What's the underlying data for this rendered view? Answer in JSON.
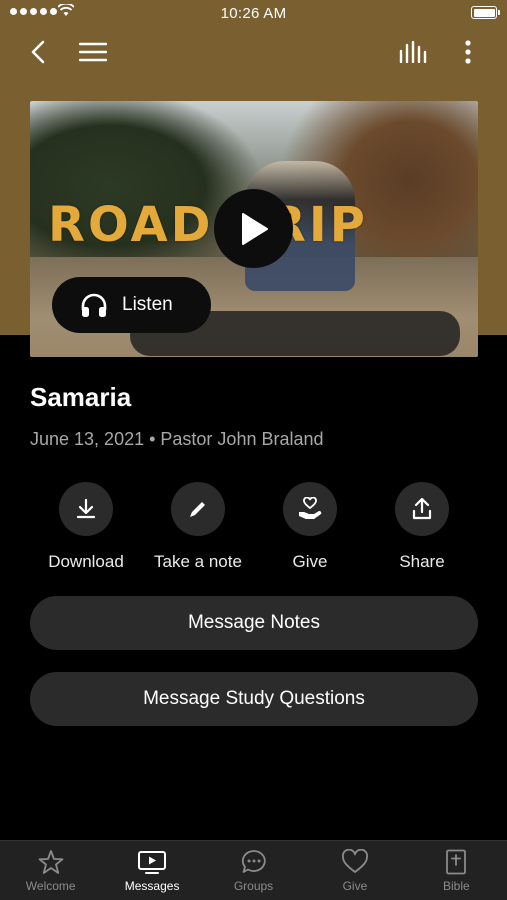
{
  "status_bar": {
    "time": "10:26 AM"
  },
  "header": {
    "back_icon": "chevron-left-icon",
    "menu_icon": "hamburger-icon",
    "audio_icon": "equalizer-icon",
    "more_icon": "more-vertical-icon"
  },
  "hero": {
    "title_art": "ROAD TRIP",
    "play_icon": "play-icon",
    "listen_label": "Listen"
  },
  "sermon": {
    "title": "Samaria",
    "meta": "June 13, 2021 • Pastor John Braland"
  },
  "actions": [
    {
      "label": "Download",
      "icon": "download-icon"
    },
    {
      "label": "Take a note",
      "icon": "pencil-icon"
    },
    {
      "label": "Give",
      "icon": "hand-heart-icon"
    },
    {
      "label": "Share",
      "icon": "share-icon"
    }
  ],
  "buttons": {
    "message_notes": "Message Notes",
    "study_questions": "Message Study Questions"
  },
  "tabs": [
    {
      "label": "Welcome",
      "icon": "star-icon",
      "active": false
    },
    {
      "label": "Messages",
      "icon": "play-screen-icon",
      "active": true
    },
    {
      "label": "Groups",
      "icon": "chat-bubble-icon",
      "active": false
    },
    {
      "label": "Give",
      "icon": "heart-icon",
      "active": false
    },
    {
      "label": "Bible",
      "icon": "bible-icon",
      "active": false
    }
  ],
  "colors": {
    "header_bg": "#7a5f30",
    "background": "#000000",
    "button_bg": "#2b2b2b",
    "tabbar_bg": "#222222",
    "title_art": "#e4a93b"
  }
}
